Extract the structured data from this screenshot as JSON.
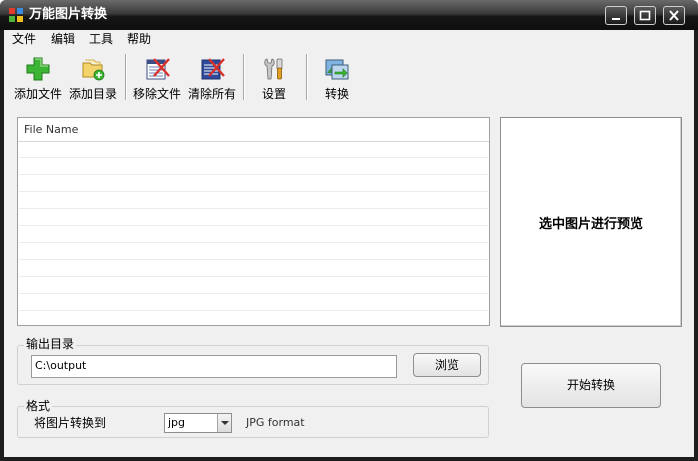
{
  "window": {
    "title": "万能图片转换",
    "icon": "app-icon"
  },
  "menu": {
    "items": [
      "文件",
      "编辑",
      "工具",
      "帮助"
    ]
  },
  "toolbar": {
    "buttons": [
      {
        "label": "添加文件",
        "icon": "add-file-icon"
      },
      {
        "label": "添加目录",
        "icon": "add-folder-icon"
      },
      {
        "label": "移除文件",
        "icon": "remove-file-icon"
      },
      {
        "label": "清除所有",
        "icon": "clear-all-icon"
      },
      {
        "label": "设置",
        "icon": "settings-icon"
      },
      {
        "label": "转换",
        "icon": "convert-icon"
      }
    ]
  },
  "file_list": {
    "column_header": "File Name"
  },
  "preview": {
    "placeholder": "选中图片进行预览"
  },
  "output": {
    "group_label": "输出目录",
    "path": "C:\\output",
    "browse_label": "浏览"
  },
  "format": {
    "group_label": "格式",
    "convert_to_label": "将图片转换到",
    "selected": "jpg",
    "description": "JPG format"
  },
  "start_button_label": "开始转换",
  "colors": {
    "titlebar": "#1d1d1d",
    "client_bg": "#f0f0f0"
  }
}
